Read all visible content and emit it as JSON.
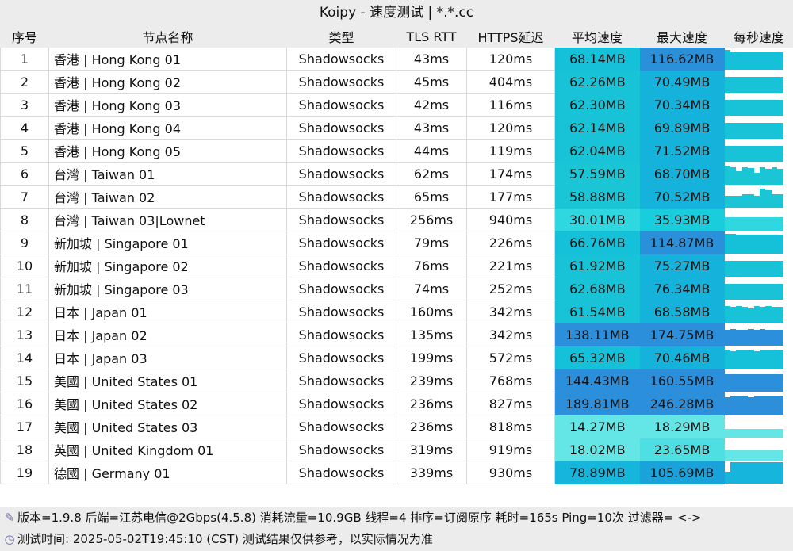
{
  "title": "Koipy - 速度测试 | *.*.cc",
  "headers": [
    "序号",
    "节点名称",
    "类型",
    "TLS RTT",
    "HTTPS延迟",
    "平均速度",
    "最大速度",
    "每秒速度"
  ],
  "rows": [
    {
      "idx": "1",
      "name": "香港 | Hong Kong 01",
      "type": "Shadowsocks",
      "tls": "43ms",
      "https": "120ms",
      "avg": "68.14MB",
      "max": "116.62MB",
      "avgColor": "#15c1d9",
      "maxColor": "#2b90da",
      "bars": [
        0.9,
        0.8,
        0.82,
        0.8,
        0.8,
        0.8,
        0.8,
        0.8,
        0.8,
        0.8
      ]
    },
    {
      "idx": "2",
      "name": "香港 | Hong Kong 02",
      "type": "Shadowsocks",
      "tls": "45ms",
      "https": "404ms",
      "avg": "62.26MB",
      "max": "70.49MB",
      "avgColor": "#18c3d7",
      "maxColor": "#15b2db",
      "bars": [
        0.7,
        0.7,
        0.7,
        0.7,
        0.7,
        0.7,
        0.7,
        0.7,
        0.7,
        0.7
      ]
    },
    {
      "idx": "3",
      "name": "香港 | Hong Kong 03",
      "type": "Shadowsocks",
      "tls": "42ms",
      "https": "116ms",
      "avg": "62.30MB",
      "max": "70.34MB",
      "avgColor": "#18c3d7",
      "maxColor": "#15b2db",
      "bars": [
        0.7,
        0.7,
        0.7,
        0.7,
        0.7,
        0.7,
        0.7,
        0.7,
        0.7,
        0.7
      ]
    },
    {
      "idx": "4",
      "name": "香港 | Hong Kong 04",
      "type": "Shadowsocks",
      "tls": "43ms",
      "https": "120ms",
      "avg": "62.14MB",
      "max": "69.89MB",
      "avgColor": "#18c3d7",
      "maxColor": "#15b2db",
      "bars": [
        0.7,
        0.7,
        0.7,
        0.7,
        0.7,
        0.7,
        0.7,
        0.7,
        0.7,
        0.7
      ]
    },
    {
      "idx": "5",
      "name": "香港 | Hong Kong 05",
      "type": "Shadowsocks",
      "tls": "44ms",
      "https": "119ms",
      "avg": "62.04MB",
      "max": "71.52MB",
      "avgColor": "#18c3d7",
      "maxColor": "#15b2db",
      "bars": [
        0.7,
        0.7,
        0.7,
        0.7,
        0.7,
        0.7,
        0.7,
        0.7,
        0.7,
        0.7
      ]
    },
    {
      "idx": "6",
      "name": "台灣 | Taiwan 01",
      "type": "Shadowsocks",
      "tls": "62ms",
      "https": "174ms",
      "avg": "57.59MB",
      "max": "68.70MB",
      "avgColor": "#1ac5d6",
      "maxColor": "#15b2db",
      "bars": [
        0.85,
        0.8,
        0.6,
        0.8,
        0.75,
        0.55,
        0.8,
        0.7,
        0.8,
        0.7
      ]
    },
    {
      "idx": "7",
      "name": "台灣 | Taiwan 02",
      "type": "Shadowsocks",
      "tls": "65ms",
      "https": "177ms",
      "avg": "58.88MB",
      "max": "70.52MB",
      "avgColor": "#1ac5d6",
      "maxColor": "#15b2db",
      "bars": [
        0.55,
        0.55,
        0.55,
        0.6,
        0.6,
        0.55,
        0.85,
        0.8,
        0.6,
        0.6
      ]
    },
    {
      "idx": "8",
      "name": "台灣 | Taiwan 03|Lownet",
      "type": "Shadowsocks",
      "tls": "256ms",
      "https": "940ms",
      "avg": "30.01MB",
      "max": "35.93MB",
      "avgColor": "#2fd8e0",
      "maxColor": "#19cddd",
      "bars": [
        0.6,
        0.6,
        0.6,
        0.6,
        0.6,
        0.6,
        0.6,
        0.6,
        0.6,
        0.6
      ]
    },
    {
      "idx": "9",
      "name": "新加坡 | Singapore 01",
      "type": "Shadowsocks",
      "tls": "79ms",
      "https": "226ms",
      "avg": "66.76MB",
      "max": "114.87MB",
      "avgColor": "#15c1d9",
      "maxColor": "#2b90da",
      "bars": [
        0.9,
        0.88,
        0.85,
        0.85,
        0.85,
        0.85,
        0.85,
        0.85,
        0.85,
        0.85
      ]
    },
    {
      "idx": "10",
      "name": "新加坡 | Singapore 02",
      "type": "Shadowsocks",
      "tls": "76ms",
      "https": "221ms",
      "avg": "61.92MB",
      "max": "75.27MB",
      "avgColor": "#18c3d7",
      "maxColor": "#15b2db",
      "bars": [
        0.7,
        0.7,
        0.7,
        0.7,
        0.7,
        0.7,
        0.7,
        0.7,
        0.7,
        0.7
      ]
    },
    {
      "idx": "11",
      "name": "新加坡 | Singapore 03",
      "type": "Shadowsocks",
      "tls": "74ms",
      "https": "252ms",
      "avg": "62.68MB",
      "max": "76.34MB",
      "avgColor": "#18c3d7",
      "maxColor": "#15b2db",
      "bars": [
        0.7,
        0.7,
        0.7,
        0.7,
        0.7,
        0.7,
        0.7,
        0.7,
        0.7,
        0.7
      ]
    },
    {
      "idx": "12",
      "name": "日本 | Japan 01",
      "type": "Shadowsocks",
      "tls": "160ms",
      "https": "342ms",
      "avg": "61.54MB",
      "max": "68.58MB",
      "avgColor": "#18c3d7",
      "maxColor": "#15b2db",
      "bars": [
        0.75,
        0.7,
        0.75,
        0.7,
        0.65,
        0.75,
        0.7,
        0.75,
        0.7,
        0.7
      ]
    },
    {
      "idx": "13",
      "name": "日本 | Japan 02",
      "type": "Shadowsocks",
      "tls": "135ms",
      "https": "342ms",
      "avg": "138.11MB",
      "max": "174.75MB",
      "avgColor": "#2b8fdb",
      "maxColor": "#2b8fdb",
      "bars": [
        0.7,
        0.75,
        0.7,
        0.7,
        0.75,
        0.7,
        0.75,
        0.7,
        0.7,
        0.7
      ]
    },
    {
      "idx": "14",
      "name": "日本 | Japan 03",
      "type": "Shadowsocks",
      "tls": "199ms",
      "https": "572ms",
      "avg": "65.32MB",
      "max": "70.46MB",
      "avgColor": "#15c1d9",
      "maxColor": "#15b2db",
      "bars": [
        0.85,
        0.8,
        0.85,
        0.85,
        0.85,
        0.8,
        0.85,
        0.85,
        0.85,
        0.85
      ]
    },
    {
      "idx": "15",
      "name": "美國 | United States 01",
      "type": "Shadowsocks",
      "tls": "239ms",
      "https": "768ms",
      "avg": "144.43MB",
      "max": "160.55MB",
      "avgColor": "#2b8fdb",
      "maxColor": "#2b8fdb",
      "bars": [
        0.8,
        0.8,
        0.8,
        0.8,
        0.8,
        0.8,
        0.8,
        0.8,
        0.8,
        0.8
      ]
    },
    {
      "idx": "16",
      "name": "美國 | United States 02",
      "type": "Shadowsocks",
      "tls": "236ms",
      "https": "827ms",
      "avg": "189.81MB",
      "max": "246.28MB",
      "avgColor": "#2b8fdb",
      "maxColor": "#2b8fdb",
      "bars": [
        0.8,
        0.85,
        0.85,
        0.85,
        0.8,
        0.85,
        0.85,
        0.85,
        0.85,
        0.85
      ]
    },
    {
      "idx": "17",
      "name": "美國 | United States 03",
      "type": "Shadowsocks",
      "tls": "236ms",
      "https": "818ms",
      "avg": "14.27MB",
      "max": "18.29MB",
      "avgColor": "#64e6e6",
      "maxColor": "#64e6e6",
      "bars": [
        0.4,
        0.4,
        0.4,
        0.4,
        0.4,
        0.4,
        0.4,
        0.4,
        0.4,
        0.4
      ]
    },
    {
      "idx": "18",
      "name": "英國 | United Kingdom 01",
      "type": "Shadowsocks",
      "tls": "319ms",
      "https": "919ms",
      "avg": "18.02MB",
      "max": "23.65MB",
      "avgColor": "#64e6e6",
      "maxColor": "#4edfe3",
      "bars": [
        0.5,
        0.5,
        0.5,
        0.5,
        0.5,
        0.5,
        0.5,
        0.5,
        0.5,
        0.5
      ]
    },
    {
      "idx": "19",
      "name": "德國 | Germany 01",
      "type": "Shadowsocks",
      "tls": "339ms",
      "https": "930ms",
      "avg": "78.89MB",
      "max": "105.69MB",
      "avgColor": "#16b5dc",
      "maxColor": "#1aa2db",
      "bars": [
        0.55,
        0.95,
        0.95,
        0.95,
        0.95,
        0.95,
        0.95,
        0.95,
        0.95,
        0.95
      ]
    }
  ],
  "footer": {
    "line1": "版本=1.9.8  后端=江苏电信@2Gbps(4.5.8) 消耗流量=10.9GB  线程=4  排序=订阅原序  耗时=165s  Ping=10次  过滤器= <->",
    "line2": "测试时间: 2025-05-02T19:45:10 (CST)  测试结果仅供参考，以实际情况为准",
    "icon1": "wrench-icon",
    "icon2": "clock-icon"
  }
}
